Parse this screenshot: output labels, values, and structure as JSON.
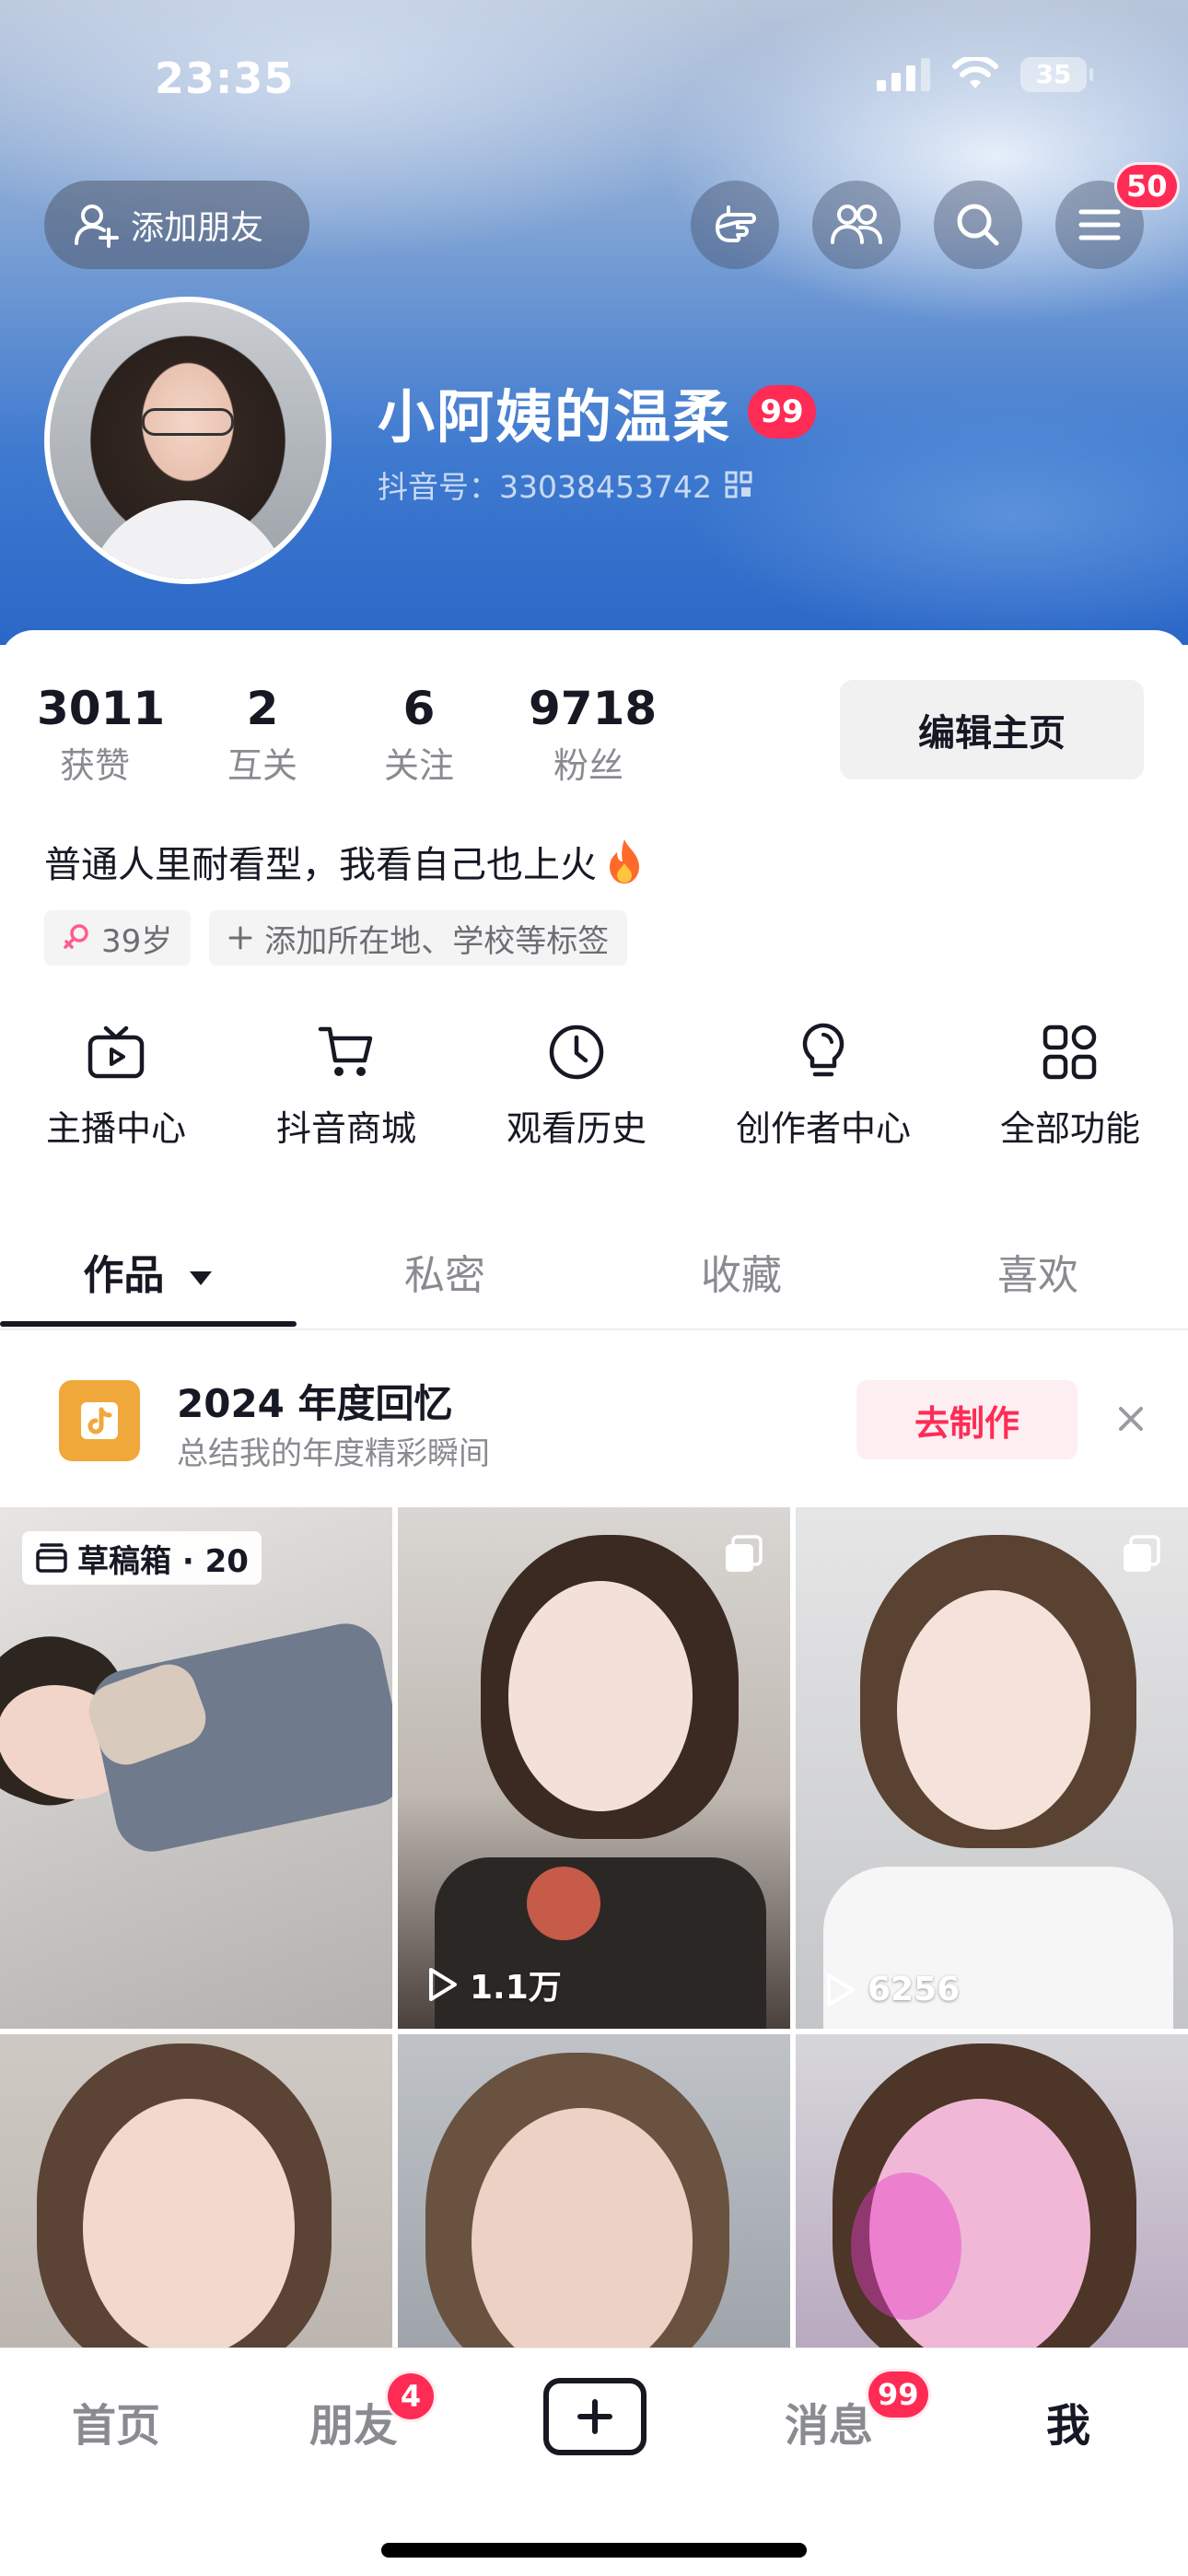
{
  "status_bar": {
    "time": "23:35",
    "battery": "35"
  },
  "header": {
    "add_friend_label": "添加朋友",
    "menu_badge": "50",
    "username": "小阿姨的温柔",
    "username_badge": "99",
    "douyin_id": "抖音号：33038453742"
  },
  "profile": {
    "stats": [
      {
        "num": "3011",
        "label": "获赞"
      },
      {
        "num": "2",
        "label": "互关"
      },
      {
        "num": "6",
        "label": "关注"
      },
      {
        "num": "9718",
        "label": "粉丝"
      }
    ],
    "edit_label": "编辑主页",
    "bio": "普通人里耐看型，我看自己也上火",
    "age_tag": "39岁",
    "add_tag": "添加所在地、学校等标签"
  },
  "features": [
    {
      "label": "主播中心",
      "icon": "tv-icon"
    },
    {
      "label": "抖音商城",
      "icon": "cart-icon"
    },
    {
      "label": "观看历史",
      "icon": "clock-icon"
    },
    {
      "label": "创作者中心",
      "icon": "bulb-icon"
    },
    {
      "label": "全部功能",
      "icon": "grid-icon"
    }
  ],
  "tabs": [
    {
      "label": "作品"
    },
    {
      "label": "私密"
    },
    {
      "label": "收藏"
    },
    {
      "label": "喜欢"
    }
  ],
  "memory": {
    "title": "2024 年度回忆",
    "subtitle": "总结我的年度精彩瞬间",
    "button": "去制作"
  },
  "grid": {
    "draft_label": "草稿箱 · 20",
    "videos": [
      {
        "plays": ""
      },
      {
        "plays": "1.1万"
      },
      {
        "plays": "6256"
      },
      {
        "plays": ""
      },
      {
        "plays": ""
      },
      {
        "plays": ""
      }
    ]
  },
  "bottom_nav": {
    "items": [
      {
        "label": "首页"
      },
      {
        "label": "朋友",
        "badge": "4"
      },
      {
        "label": "消息",
        "badge": "99"
      },
      {
        "label": "我"
      }
    ]
  },
  "colors": {
    "accent": "#fe2c55",
    "text": "#161823",
    "muted": "#8a8b91"
  }
}
